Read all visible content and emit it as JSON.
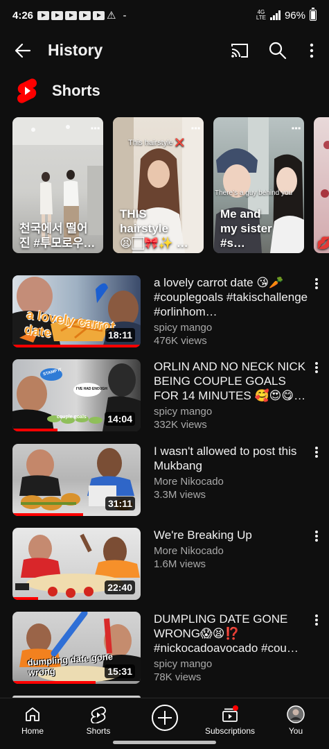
{
  "status_bar": {
    "time": "4:26",
    "network": "4G",
    "network_sub": "LTE",
    "battery": "96%"
  },
  "header": {
    "title": "History",
    "icons": [
      "back-arrow-icon",
      "cast-icon",
      "search-icon",
      "more-vert-icon"
    ]
  },
  "shorts": {
    "title": "Shorts",
    "items": [
      {
        "caption": "천국에서 떨어\n진 #투모로우…"
      },
      {
        "caption": "THIS hairstyle\n😫🏻🎀✨ …",
        "overlay": "This hairstyle ❌"
      },
      {
        "caption": "Me and\nmy sister #s…",
        "overlay": "There’s a guy behind you"
      },
      {
        "caption": "💋"
      }
    ]
  },
  "videos": [
    {
      "title": "a lovely carrot date 😘🥕 #couplegoals #takischallenge #orlinhom…",
      "channel": "spicy mango",
      "views": "476K views",
      "duration": "18:11",
      "thumb_text": "a lovely carrot date",
      "progress": 1.0
    },
    {
      "title": "ORLIN AND NO NECK NICK BEING COUPLE GOALS FOR 14 MINUTES 🥰😍😋…",
      "channel": "spicy mango",
      "views": "332K views",
      "duration": "14:04",
      "thumb_text": "couple goals",
      "thumb_bubble1": "STAMP IT",
      "thumb_bubble2": "I'VE HAD ENOUGH",
      "progress": 0.35
    },
    {
      "title": "I wasn't allowed to post this Mukbang",
      "channel": "More Nikocado",
      "views": "3.3M views",
      "duration": "31:11",
      "progress": 0.55
    },
    {
      "title": "We're Breaking Up",
      "channel": "More Nikocado",
      "views": "1.6M views",
      "duration": "22:40",
      "progress": 0.2
    },
    {
      "title": "DUMPLING DATE GONE WRONG😱😫⁉️ #nickocadoavocado #cou…",
      "channel": "spicy mango",
      "views": "78K views",
      "duration": "15:31",
      "thumb_text": "dumpling date gone wrong",
      "progress": 0.65
    }
  ],
  "bottom_nav": {
    "home": "Home",
    "shorts": "Shorts",
    "subscriptions": "Subscriptions",
    "you": "You"
  },
  "colors": {
    "background": "#0f0f0f",
    "accent_red": "#ff0000",
    "text_primary": "#f1f1f1",
    "text_secondary": "#aaaaaa"
  }
}
